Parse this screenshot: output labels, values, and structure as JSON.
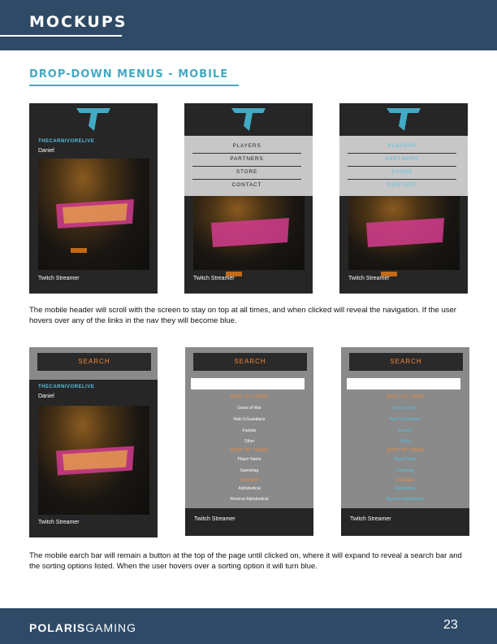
{
  "header": {
    "title": "MOCKUPS"
  },
  "section": {
    "title": "DROP-DOWN MENUS - MOBILE"
  },
  "profile": {
    "channel": "THECARNIVORELIVE",
    "user": "Daniel",
    "role": "Twitch Streamer"
  },
  "nav": {
    "items": [
      "PLAYERS",
      "PARTNERS",
      "STORE",
      "CONTACT"
    ]
  },
  "search": {
    "button_label": "SEARCH",
    "sort_by_game_label": "SORT BY GAME",
    "games": [
      "Gears of War",
      "Halo 5:Guardians",
      "Fortnite",
      "Other"
    ],
    "sort_by_name_label": "SORT BY NAME",
    "names": [
      "Player Name",
      "Gamertag"
    ],
    "order_label": "ORDER",
    "orders": [
      "Alphabetical",
      "Reverse Alphabetical"
    ]
  },
  "paragraphs": {
    "nav_desc": "The mobile header will scroll with the screen to stay on top at all times, and when clicked will reveal the navigation. If the user hovers over any of the links in the nav they will become blue.",
    "search_desc": "The mobile earch bar will remain a button at the top of the page until clicked on, where it will expand to reveal a search bar and the sorting options listed. When the user hovers over a sorting option it will turn blue."
  },
  "footer": {
    "brand_bold": "POLARIS",
    "brand_light": "GAMING",
    "page_number": "23"
  },
  "colors": {
    "accent": "#43aac4",
    "band": "#2e4a66",
    "orange": "#f08a3c",
    "hover_blue": "#56c0e0"
  }
}
